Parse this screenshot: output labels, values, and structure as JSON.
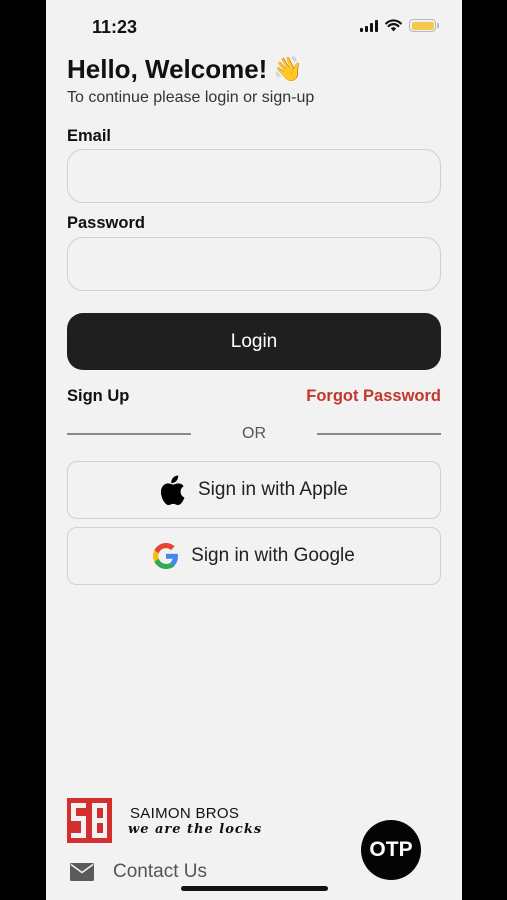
{
  "status_bar": {
    "time": "11:23"
  },
  "header": {
    "title": "Hello, Welcome!",
    "wave_emoji": "👋",
    "subtitle": "To continue please login or sign-up"
  },
  "form": {
    "email_label": "Email",
    "email_value": "",
    "password_label": "Password",
    "password_value": "",
    "login_label": "Login"
  },
  "links": {
    "sign_up": "Sign Up",
    "forgot_password": "Forgot Password"
  },
  "divider_text": "OR",
  "social": {
    "apple_label": "Sign in with Apple",
    "google_label": "Sign in with Google"
  },
  "footer": {
    "brand_name": "SAIMON BROS",
    "brand_tagline": "we are the locks",
    "contact_label": "Contact Us",
    "otp_label": "OTP"
  },
  "colors": {
    "accent_red": "#c0392b",
    "button_dark": "#1f1f1f",
    "background": "#f2f2f2"
  },
  "icons": [
    "signal-icon",
    "wifi-icon",
    "battery-icon",
    "apple-icon",
    "google-icon",
    "mail-icon",
    "brand-logo"
  ]
}
